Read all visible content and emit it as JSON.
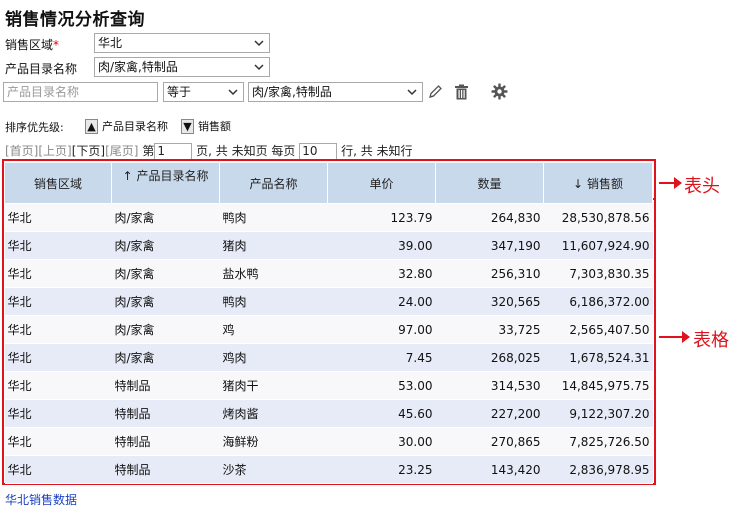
{
  "title": "销售情况分析查询",
  "filters": {
    "region_label": "销售区域",
    "region_required": "*",
    "region_value": "华北",
    "catalog_label": "产品目录名称",
    "catalog_value": "肉/家禽,特制品"
  },
  "condition": {
    "field_placeholder": "产品目录名称",
    "operator": "等于",
    "value": "肉/家禽,特制品"
  },
  "sort": {
    "label": "排序优先级:",
    "items": [
      {
        "label": "产品目录名称",
        "direction": "asc"
      },
      {
        "label": "销售额",
        "direction": "desc"
      }
    ]
  },
  "pager": {
    "first": "[首页]",
    "prev": "[上页]",
    "next": "[下页]",
    "last": "[尾页]",
    "page_prefix": "第",
    "page_value": "1",
    "page_suffix": "页, 共 未知页 每页",
    "rows_value": "10",
    "rows_suffix": "行, 共 未知行"
  },
  "table": {
    "columns": [
      "销售区域",
      "产品目录名称",
      "产品名称",
      "单价",
      "数量",
      "销售额"
    ],
    "sort_arrows": [
      "",
      "↑",
      "",
      "",
      "",
      "↓"
    ],
    "rows": [
      [
        "华北",
        "肉/家禽",
        "鸭肉",
        "123.79",
        "264,830",
        "28,530,878.56"
      ],
      [
        "华北",
        "肉/家禽",
        "猪肉",
        "39.00",
        "347,190",
        "11,607,924.90"
      ],
      [
        "华北",
        "肉/家禽",
        "盐水鸭",
        "32.80",
        "256,310",
        "7,303,830.35"
      ],
      [
        "华北",
        "肉/家禽",
        "鸭肉",
        "24.00",
        "320,565",
        "6,186,372.00"
      ],
      [
        "华北",
        "肉/家禽",
        "鸡",
        "97.00",
        "33,725",
        "2,565,407.50"
      ],
      [
        "华北",
        "肉/家禽",
        "鸡肉",
        "7.45",
        "268,025",
        "1,678,524.31"
      ],
      [
        "华北",
        "特制品",
        "猪肉干",
        "53.00",
        "314,530",
        "14,845,975.75"
      ],
      [
        "华北",
        "特制品",
        "烤肉酱",
        "45.60",
        "227,200",
        "9,122,307.20"
      ],
      [
        "华北",
        "特制品",
        "海鲜粉",
        "30.00",
        "270,865",
        "7,825,726.50"
      ],
      [
        "华北",
        "特制品",
        "沙茶",
        "23.25",
        "143,420",
        "2,836,978.95"
      ]
    ]
  },
  "annotations": {
    "header": "表头",
    "body": "表格"
  },
  "footer_link": "华北销售数据",
  "colors": {
    "accent_red": "#e0121c",
    "header_bg": "#c9d9ec",
    "row_even": "#e6ebf7",
    "row_odd": "#f8f8fa",
    "link": "#1a3fbf"
  }
}
